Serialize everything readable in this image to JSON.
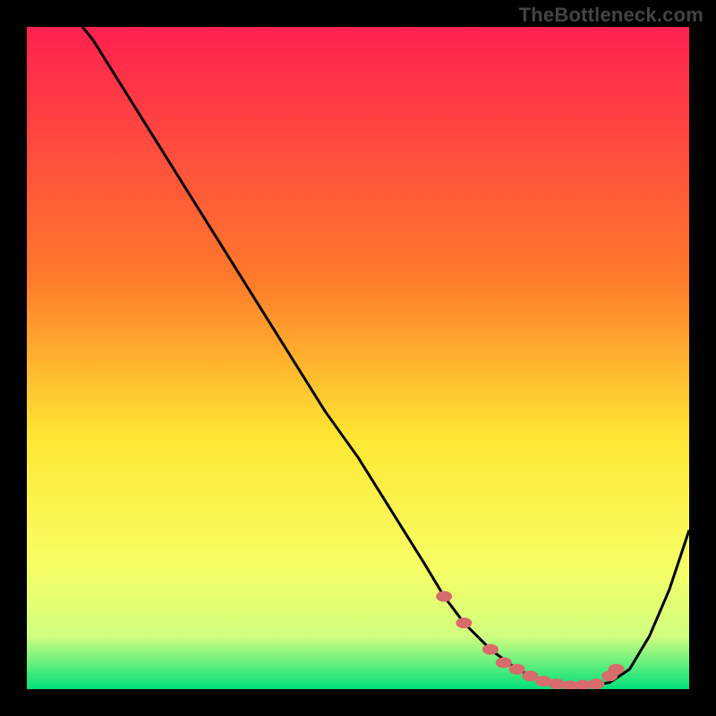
{
  "watermark": "TheBottleneck.com",
  "colors": {
    "bg": "#000000",
    "line": "#000000",
    "marker": "#d86b6b",
    "grad_top": "#ff2050",
    "grad_mid1": "#ff7a2a",
    "grad_mid2": "#ffe733",
    "grad_mid3": "#f6ff66",
    "grad_bot1": "#d0ff80",
    "grad_bot2": "#00e07a"
  },
  "chart_data": {
    "type": "line",
    "title": "",
    "xlabel": "",
    "ylabel": "",
    "xlim": [
      0,
      100
    ],
    "ylim": [
      0,
      100
    ],
    "grid": false,
    "series": [
      {
        "name": "curve",
        "x": [
          0,
          3,
          6,
          10,
          15,
          20,
          25,
          30,
          35,
          40,
          45,
          50,
          55,
          60,
          63,
          66,
          70,
          74,
          78,
          82,
          85,
          88,
          91,
          94,
          97,
          100
        ],
        "y": [
          111,
          107,
          103,
          98,
          90,
          82,
          74,
          66,
          58,
          50,
          42,
          35,
          27,
          19,
          14,
          10,
          6,
          3,
          1.2,
          0.5,
          0.5,
          1,
          3,
          8,
          15,
          24
        ]
      }
    ],
    "markers": {
      "name": "highlight",
      "x": [
        63,
        66,
        70,
        72,
        74,
        76,
        78,
        80,
        82,
        84,
        86,
        88,
        89
      ],
      "y": [
        14,
        10,
        6,
        4,
        3,
        2,
        1.2,
        0.8,
        0.5,
        0.6,
        0.8,
        2,
        3
      ]
    }
  }
}
